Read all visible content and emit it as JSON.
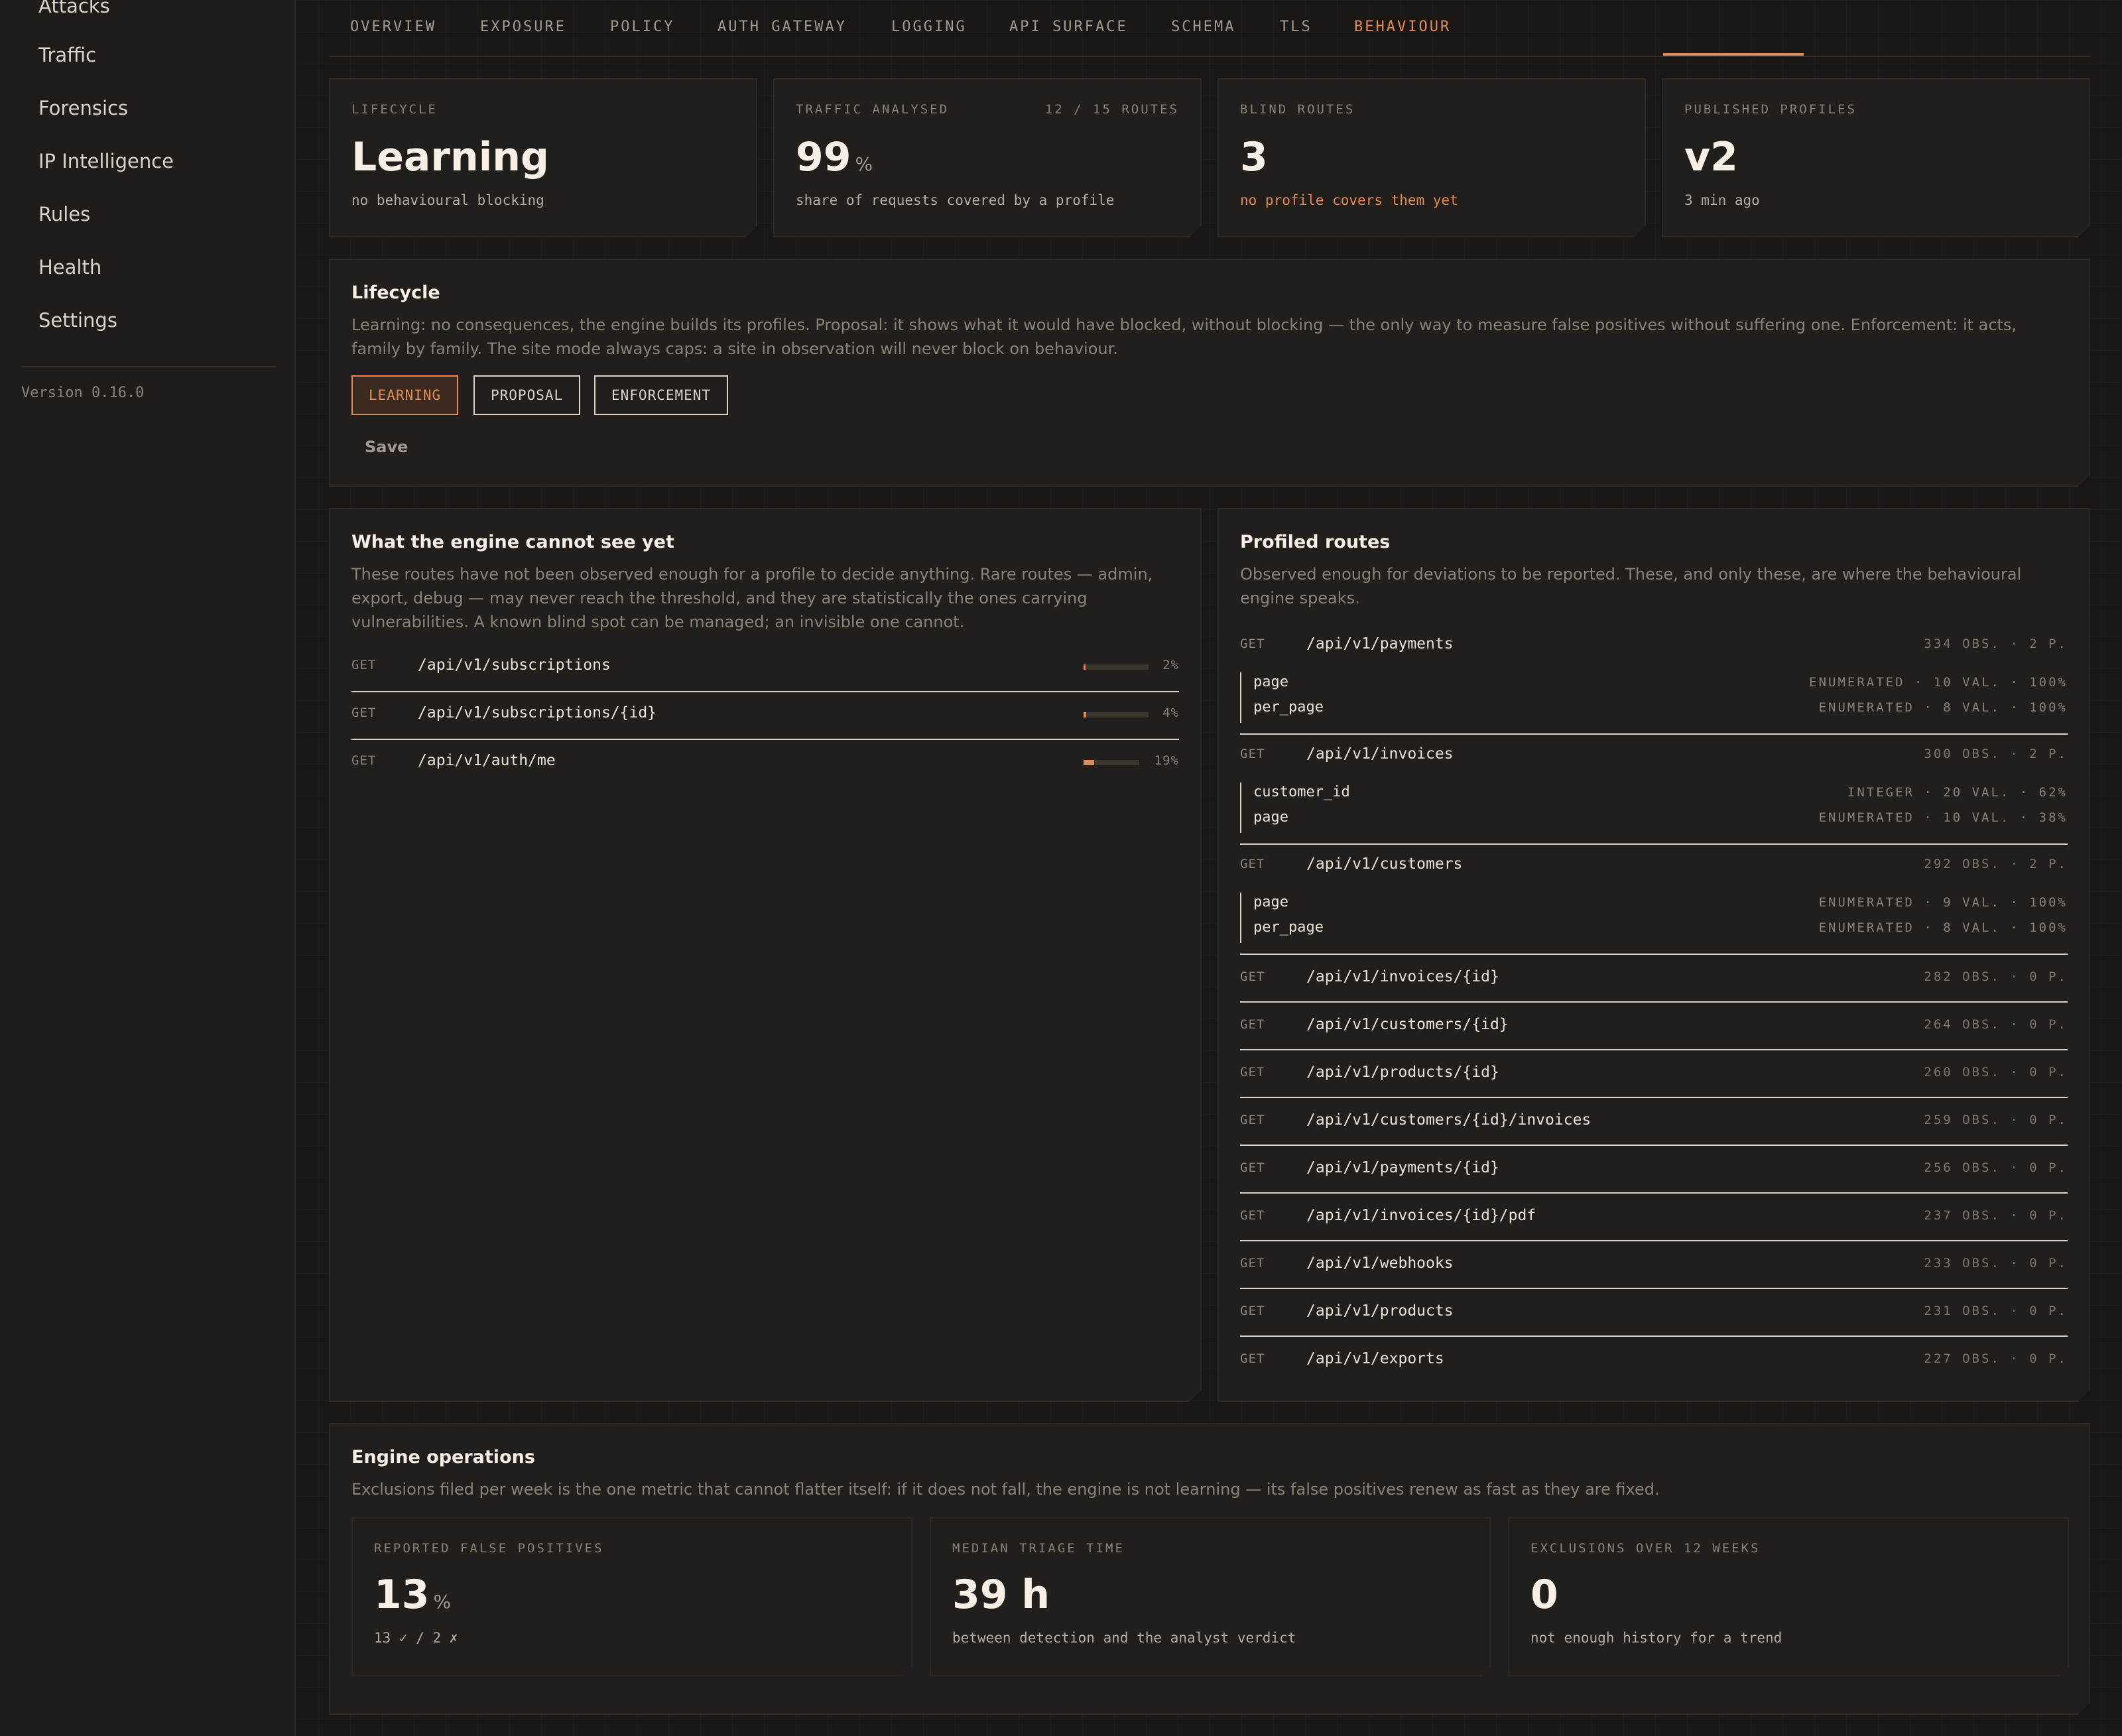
{
  "sidebar": {
    "items": [
      {
        "label": "Attacks"
      },
      {
        "label": "Traffic"
      },
      {
        "label": "Forensics"
      },
      {
        "label": "IP Intelligence"
      },
      {
        "label": "Rules"
      },
      {
        "label": "Health"
      },
      {
        "label": "Settings"
      }
    ],
    "version": "Version 0.16.0"
  },
  "tabs": [
    {
      "label": "OVERVIEW"
    },
    {
      "label": "EXPOSURE"
    },
    {
      "label": "POLICY"
    },
    {
      "label": "AUTH GATEWAY"
    },
    {
      "label": "LOGGING"
    },
    {
      "label": "API SURFACE"
    },
    {
      "label": "SCHEMA"
    },
    {
      "label": "TLS"
    },
    {
      "label": "BEHAVIOUR",
      "active": true
    }
  ],
  "stats": {
    "lifecycle": {
      "label": "LIFECYCLE",
      "value": "Learning",
      "sub": "no behavioural blocking"
    },
    "traffic": {
      "label": "TRAFFIC ANALYSED",
      "right": "12 / 15 ROUTES",
      "value": "99",
      "unit": "%",
      "sub": "share of requests covered by a profile"
    },
    "blind": {
      "label": "BLIND ROUTES",
      "value": "3",
      "sub": "no profile covers them yet"
    },
    "published": {
      "label": "PUBLISHED PROFILES",
      "value": "v2",
      "sub": "3 min ago"
    }
  },
  "lifecycle_panel": {
    "title": "Lifecycle",
    "desc_line1": "Learning: no consequences, the engine builds its profiles. Proposal: it shows what it would have blocked, without blocking — the only way to measure false positives without suffering one. Enforcement: it acts,",
    "desc_line2": "family by family. The site mode always caps: a site in observation will never block on behaviour.",
    "modes": [
      "LEARNING",
      "PROPOSAL",
      "ENFORCEMENT"
    ],
    "active_mode": "LEARNING",
    "save": "Save"
  },
  "blind_panel": {
    "title": "What the engine cannot see yet",
    "desc_line1": "These routes have not been observed enough for a profile to decide anything. Rare routes — admin,",
    "desc_line2": "export, debug — may never reach the threshold, and they are statistically the ones carrying",
    "desc_line3": "vulnerabilities. A known blind spot can be managed; an invisible one cannot.",
    "routes": [
      {
        "method": "GET",
        "path": "/api/v1/subscriptions",
        "pct_label": "2%",
        "progress": 0.02
      },
      {
        "method": "GET",
        "path": "/api/v1/subscriptions/{id}",
        "pct_label": "4%",
        "progress": 0.04
      },
      {
        "method": "GET",
        "path": "/api/v1/auth/me",
        "pct_label": "19%",
        "progress": 0.19
      }
    ]
  },
  "profiled_panel": {
    "title": "Profiled routes",
    "desc_line1": "Observed enough for deviations to be reported. These, and only these, are where the behavioural",
    "desc_line2": "engine speaks.",
    "routes": [
      {
        "method": "GET",
        "path": "/api/v1/payments",
        "meta": "334 OBS. · 2 P.",
        "params": [
          {
            "name": "page",
            "meta": "ENUMERATED · 10 VAL. · 100%"
          },
          {
            "name": "per_page",
            "meta": "ENUMERATED · 8 VAL. · 100%"
          }
        ]
      },
      {
        "method": "GET",
        "path": "/api/v1/invoices",
        "meta": "300 OBS. · 2 P.",
        "params": [
          {
            "name": "customer_id",
            "meta": "INTEGER · 20 VAL. · 62%"
          },
          {
            "name": "page",
            "meta": "ENUMERATED · 10 VAL. · 38%"
          }
        ]
      },
      {
        "method": "GET",
        "path": "/api/v1/customers",
        "meta": "292 OBS. · 2 P.",
        "params": [
          {
            "name": "page",
            "meta": "ENUMERATED · 9 VAL. · 100%"
          },
          {
            "name": "per_page",
            "meta": "ENUMERATED · 8 VAL. · 100%"
          }
        ]
      },
      {
        "method": "GET",
        "path": "/api/v1/invoices/{id}",
        "meta": "282 OBS. · 0 P."
      },
      {
        "method": "GET",
        "path": "/api/v1/customers/{id}",
        "meta": "264 OBS. · 0 P."
      },
      {
        "method": "GET",
        "path": "/api/v1/products/{id}",
        "meta": "260 OBS. · 0 P."
      },
      {
        "method": "GET",
        "path": "/api/v1/customers/{id}/invoices",
        "meta": "259 OBS. · 0 P."
      },
      {
        "method": "GET",
        "path": "/api/v1/payments/{id}",
        "meta": "256 OBS. · 0 P."
      },
      {
        "method": "GET",
        "path": "/api/v1/invoices/{id}/pdf",
        "meta": "237 OBS. · 0 P."
      },
      {
        "method": "GET",
        "path": "/api/v1/webhooks",
        "meta": "233 OBS. · 0 P."
      },
      {
        "method": "GET",
        "path": "/api/v1/products",
        "meta": "231 OBS. · 0 P."
      },
      {
        "method": "GET",
        "path": "/api/v1/exports",
        "meta": "227 OBS. · 0 P."
      }
    ]
  },
  "engine_panel": {
    "title": "Engine operations",
    "desc": "Exclusions filed per week is the one metric that cannot flatter itself: if it does not fall, the engine is not learning — its false positives renew as fast as they are fixed.",
    "cards": [
      {
        "label": "REPORTED FALSE POSITIVES",
        "value": "13",
        "unit": "%",
        "sub": "13 ✓ / 2 ✗"
      },
      {
        "label": "MEDIAN TRIAGE TIME",
        "value": "39 h",
        "unit": "",
        "sub": "between detection and the analyst verdict"
      },
      {
        "label": "EXCLUSIONS OVER 12 WEEKS",
        "value": "0",
        "unit": "",
        "sub": "not enough history for a trend"
      }
    ]
  }
}
